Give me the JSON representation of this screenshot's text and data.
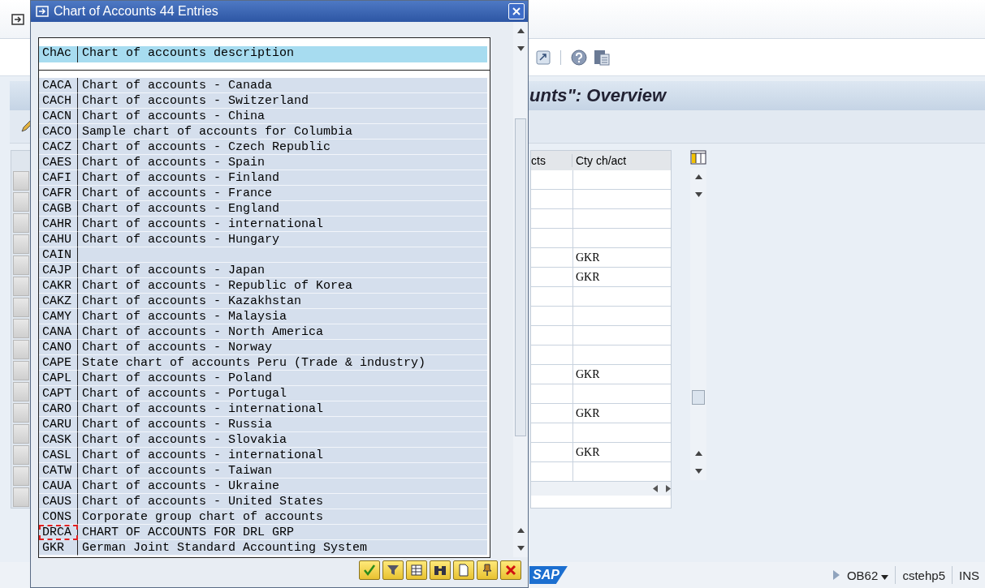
{
  "screen": {
    "title": "unts\": Overview",
    "table": {
      "columns": [
        "cts",
        "Cty ch/act"
      ],
      "rows": [
        {},
        {},
        {},
        {},
        {
          "cty": "GKR"
        },
        {
          "cty": "GKR"
        },
        {},
        {},
        {},
        {},
        {
          "cty": "GKR"
        },
        {},
        {
          "cty": "GKR"
        },
        {},
        {
          "cty": "GKR"
        },
        {}
      ]
    }
  },
  "status_bar": {
    "logo": "SAP",
    "transaction": "OB62",
    "system": "cstehp5",
    "mode": "INS"
  },
  "popup": {
    "title": "Chart of Accounts 44 Entries",
    "header": {
      "code": "ChAc",
      "description": "Chart of accounts description"
    },
    "rows": [
      {
        "code": "CACA",
        "description": "Chart of accounts - Canada",
        "selected": false
      },
      {
        "code": "CACH",
        "description": "Chart of accounts - Switzerland",
        "selected": false
      },
      {
        "code": "CACN",
        "description": "Chart of accounts - China",
        "selected": false
      },
      {
        "code": "CACO",
        "description": "Sample chart of accounts for Columbia",
        "selected": false
      },
      {
        "code": "CACZ",
        "description": "Chart of accounts - Czech Republic",
        "selected": false
      },
      {
        "code": "CAES",
        "description": "Chart of accounts - Spain",
        "selected": false
      },
      {
        "code": "CAFI",
        "description": "Chart of accounts - Finland",
        "selected": false
      },
      {
        "code": "CAFR",
        "description": "Chart of accounts - France",
        "selected": false
      },
      {
        "code": "CAGB",
        "description": "Chart of accounts - England",
        "selected": false
      },
      {
        "code": "CAHR",
        "description": "Chart of accounts - international",
        "selected": false
      },
      {
        "code": "CAHU",
        "description": "Chart of accounts - Hungary",
        "selected": false
      },
      {
        "code": "CAIN",
        "selected": false
      },
      {
        "code": "CAJP",
        "description": "Chart of accounts - Japan",
        "selected": false
      },
      {
        "code": "CAKR",
        "description": "Chart of accounts - Republic of Korea",
        "selected": false
      },
      {
        "code": "CAKZ",
        "description": "Chart of accounts - Kazakhstan",
        "selected": false
      },
      {
        "code": "CAMY",
        "description": "Chart of accounts - Malaysia",
        "selected": false
      },
      {
        "code": "CANA",
        "description": "Chart of accounts - North America",
        "selected": false
      },
      {
        "code": "CANO",
        "description": "Chart of accounts - Norway",
        "selected": false
      },
      {
        "code": "CAPE",
        "description": "State chart of accounts Peru (Trade & industry)",
        "selected": false
      },
      {
        "code": "CAPL",
        "description": "Chart of accounts - Poland",
        "selected": false
      },
      {
        "code": "CAPT",
        "description": "Chart of accounts - Portugal",
        "selected": false
      },
      {
        "code": "CARO",
        "description": "Chart of accounts - international",
        "selected": false
      },
      {
        "code": "CARU",
        "description": "Chart of accounts - Russia",
        "selected": false
      },
      {
        "code": "CASK",
        "description": "Chart of accounts - Slovakia",
        "selected": false
      },
      {
        "code": "CASL",
        "description": "Chart of accounts - international",
        "selected": false
      },
      {
        "code": "CATW",
        "description": "Chart of accounts - Taiwan",
        "selected": false
      },
      {
        "code": "CAUA",
        "description": "Chart of accounts - Ukraine",
        "selected": false
      },
      {
        "code": "CAUS",
        "description": "Chart of accounts - United States",
        "selected": false
      },
      {
        "code": "CONS",
        "description": "Corporate group chart of accounts",
        "selected": false
      },
      {
        "code": "DRCA",
        "description": "CHART OF ACCOUNTS FOR DRL GRP",
        "selected": true
      },
      {
        "code": "GKR",
        "description": "German Joint Standard Accounting System",
        "selected": false
      }
    ]
  }
}
